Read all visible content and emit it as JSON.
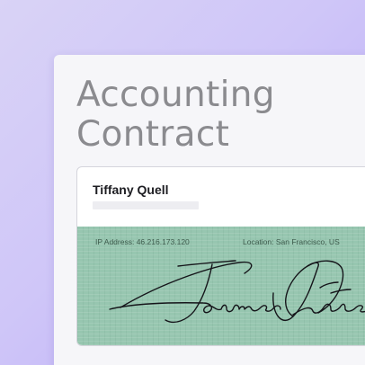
{
  "document": {
    "title_line1": "Accounting",
    "title_line2": "Contract"
  },
  "signature_card": {
    "signer_name": "Tiffany Quell",
    "ip_label": "IP Address:",
    "ip_value": "46.216.173.120",
    "location_label": "Location:",
    "location_value": "San Francisco, US",
    "signature_icon": "handwritten-signature"
  },
  "colors": {
    "background_start": "#d9d3f6",
    "background_end": "#b9a9f7",
    "signature_panel": "#97c6b0",
    "title_text": "#8b8b8f"
  }
}
